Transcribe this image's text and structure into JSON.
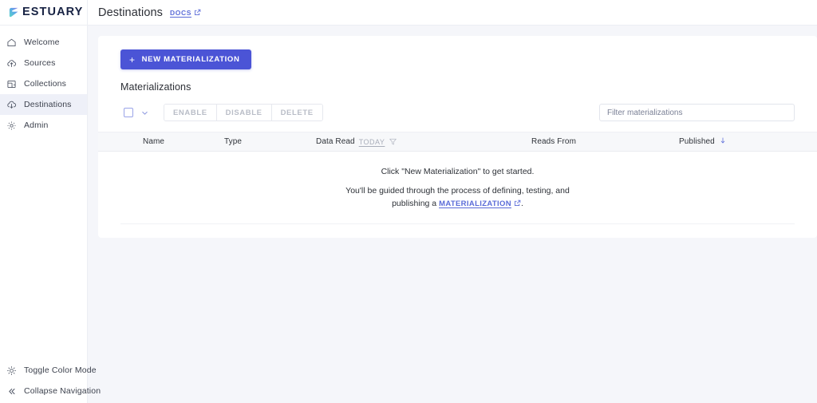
{
  "brand": {
    "name": "ESTUARY",
    "logo_icon": "estuary-wave-logo",
    "accent_color": "#4b54d6",
    "logo_text_color": "#172243"
  },
  "header": {
    "title": "Destinations",
    "docs_label": "DOCS",
    "docs_icon": "external-link-icon"
  },
  "sidebar": {
    "items": [
      {
        "label": "Welcome",
        "icon": "home-icon",
        "active": false
      },
      {
        "label": "Sources",
        "icon": "cloud-upload-icon",
        "active": false
      },
      {
        "label": "Collections",
        "icon": "collections-icon",
        "active": false
      },
      {
        "label": "Destinations",
        "icon": "cloud-download-icon",
        "active": true
      },
      {
        "label": "Admin",
        "icon": "gear-icon",
        "active": false
      }
    ],
    "bottom_items": [
      {
        "label": "Toggle Color Mode",
        "icon": "sun-icon"
      },
      {
        "label": "Collapse Navigation",
        "icon": "chevron-double-left-icon"
      }
    ]
  },
  "main": {
    "new_button": {
      "label": "NEW MATERIALIZATION",
      "icon": "plus-icon"
    },
    "section_title": "Materializations",
    "toolbar": {
      "select_all_checkbox": "unchecked",
      "select_menu_icon": "chevron-down-icon",
      "enable_label": "ENABLE",
      "disable_label": "DISABLE",
      "delete_label": "DELETE",
      "filter_placeholder": "Filter materializations",
      "filter_value": ""
    },
    "table": {
      "columns": [
        {
          "label": "Name"
        },
        {
          "label": "Type"
        },
        {
          "label": "Data Read",
          "filter_label": "TODAY",
          "filter_icon": "funnel-icon"
        },
        {
          "label": "Reads From"
        },
        {
          "label": "Published",
          "sort_icon": "arrow-down-icon"
        }
      ],
      "rows": [],
      "empty_state": {
        "line1": "Click \"New Materialization\" to get started.",
        "line2_prefix": "You'll be guided through the process of defining, testing, and publishing a",
        "link_label": "MATERIALIZATION",
        "link_icon": "external-link-icon",
        "line2_suffix": "."
      }
    }
  }
}
